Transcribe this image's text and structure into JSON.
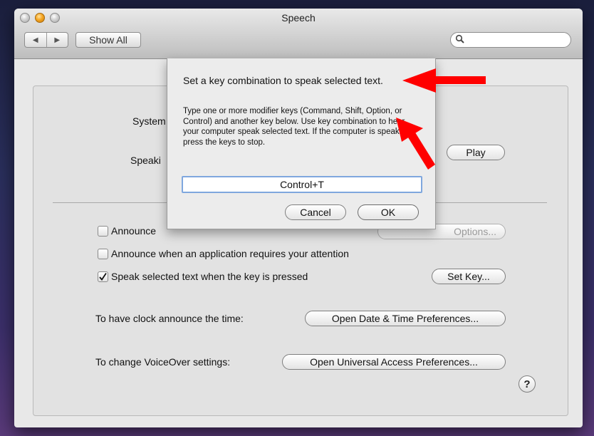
{
  "window": {
    "title": "Speech",
    "nav_back": "◀",
    "nav_forward": "▶",
    "show_all": "Show All",
    "search_placeholder": ""
  },
  "settings": {
    "system_voice_label": "System",
    "speaking_rate_label": "Speaki",
    "play_button": "Play",
    "alerts": {
      "label": "Announce",
      "checked": false,
      "options_button": "Options..."
    },
    "attention": {
      "label": "Announce when an application requires your attention",
      "checked": false
    },
    "speak_selected": {
      "label": "Speak selected text when the key is pressed",
      "checked": true,
      "set_key_button": "Set Key..."
    },
    "clock_label": "To have clock announce the time:",
    "clock_button": "Open Date & Time Preferences...",
    "voiceover_label": "To change VoiceOver settings:",
    "voiceover_button": "Open Universal Access Preferences...",
    "help_button": "?"
  },
  "sheet": {
    "title": "Set a key combination to speak selected text.",
    "body": "Type one or more modifier keys (Command, Shift, Option, or Control) and another key below. Use key combination to hear your computer speak selected text. If the computer is speaking, press the keys to stop.",
    "key_value": "Control+T",
    "cancel_button": "Cancel",
    "ok_button": "OK"
  },
  "colors": {
    "accent_field_border": "#7fa7de",
    "annotation_arrow": "#ff0000"
  }
}
